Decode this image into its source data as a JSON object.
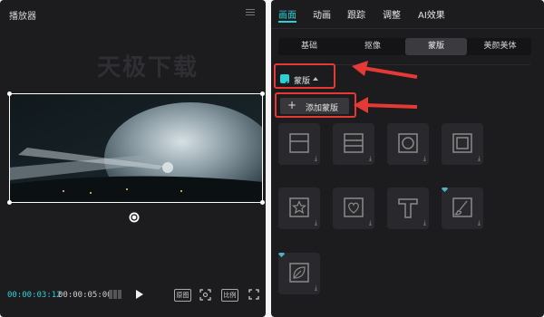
{
  "player": {
    "title": "播放器",
    "watermark": "天极下载",
    "current_time": "00:00:03:12",
    "total_time": "00:00:05:00",
    "buttons": {
      "ratio1": "原图",
      "ratio2": "比例"
    }
  },
  "editor": {
    "tabs": [
      "画面",
      "动画",
      "跟踪",
      "调整",
      "AI效果"
    ],
    "active_tab": "画面",
    "subtabs": [
      "基础",
      "抠像",
      "蒙版",
      "美颜美体"
    ],
    "active_subtab": "蒙版",
    "mask_checkbox_label": "蒙版",
    "mask_checkbox_checked": true,
    "add_mask_label": "添加蒙版",
    "mask_tiles": [
      {
        "name": "line-mask",
        "icon": "line-mask-icon"
      },
      {
        "name": "mirror-mask",
        "icon": "mirror-mask-icon"
      },
      {
        "name": "circle-mask",
        "icon": "circle-mask-icon"
      },
      {
        "name": "rectangle-mask",
        "icon": "rectangle-mask-icon"
      },
      {
        "name": "star-mask",
        "icon": "star-mask-icon"
      },
      {
        "name": "heart-mask",
        "icon": "heart-mask-icon"
      },
      {
        "name": "text-mask",
        "icon": "text-mask-icon"
      },
      {
        "name": "brush-mask",
        "icon": "brush-mask-icon",
        "premium": true
      },
      {
        "name": "leaf-mask",
        "icon": "leaf-mask-icon",
        "premium": true
      }
    ]
  },
  "colors": {
    "accent": "#2ccfd4",
    "panel": "#1c1c1f",
    "annotation": "#e53935"
  }
}
